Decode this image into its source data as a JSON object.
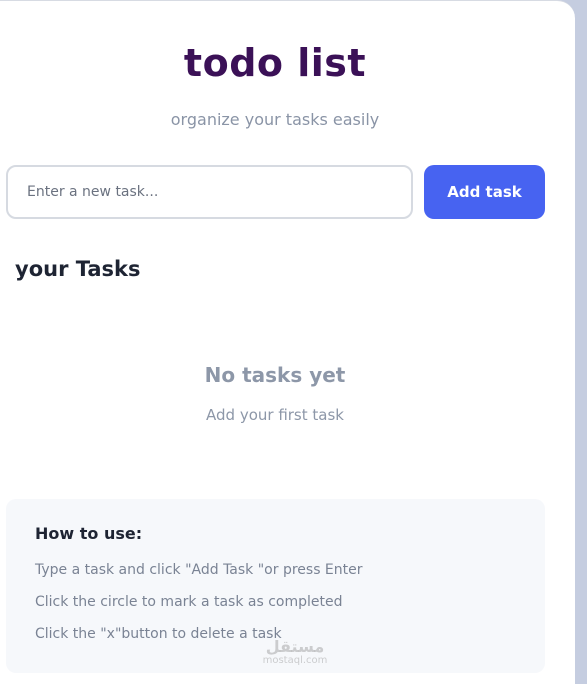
{
  "header": {
    "title": "todo list",
    "subtitle": "organize your tasks easily"
  },
  "form": {
    "input_placeholder": "Enter a new task...",
    "input_value": "",
    "add_button_label": "Add task"
  },
  "tasks_section": {
    "title": "your Tasks",
    "tasks": [],
    "empty_title": "No tasks yet",
    "empty_subtitle": "Add your first task"
  },
  "help": {
    "title": "How to use:",
    "items": [
      "Type a task and click \"Add Task \"or press Enter",
      "Click the circle to mark a task as completed",
      "Click the \"x\"button to delete a task"
    ]
  },
  "watermark": {
    "arabic": "مستقل",
    "latin": "mostaql.com"
  },
  "colors": {
    "title": "#3b1157",
    "accent": "#4763f1",
    "background": "#c5cde0",
    "muted_text": "#8d97a8",
    "help_bg": "#f6f8fb"
  }
}
